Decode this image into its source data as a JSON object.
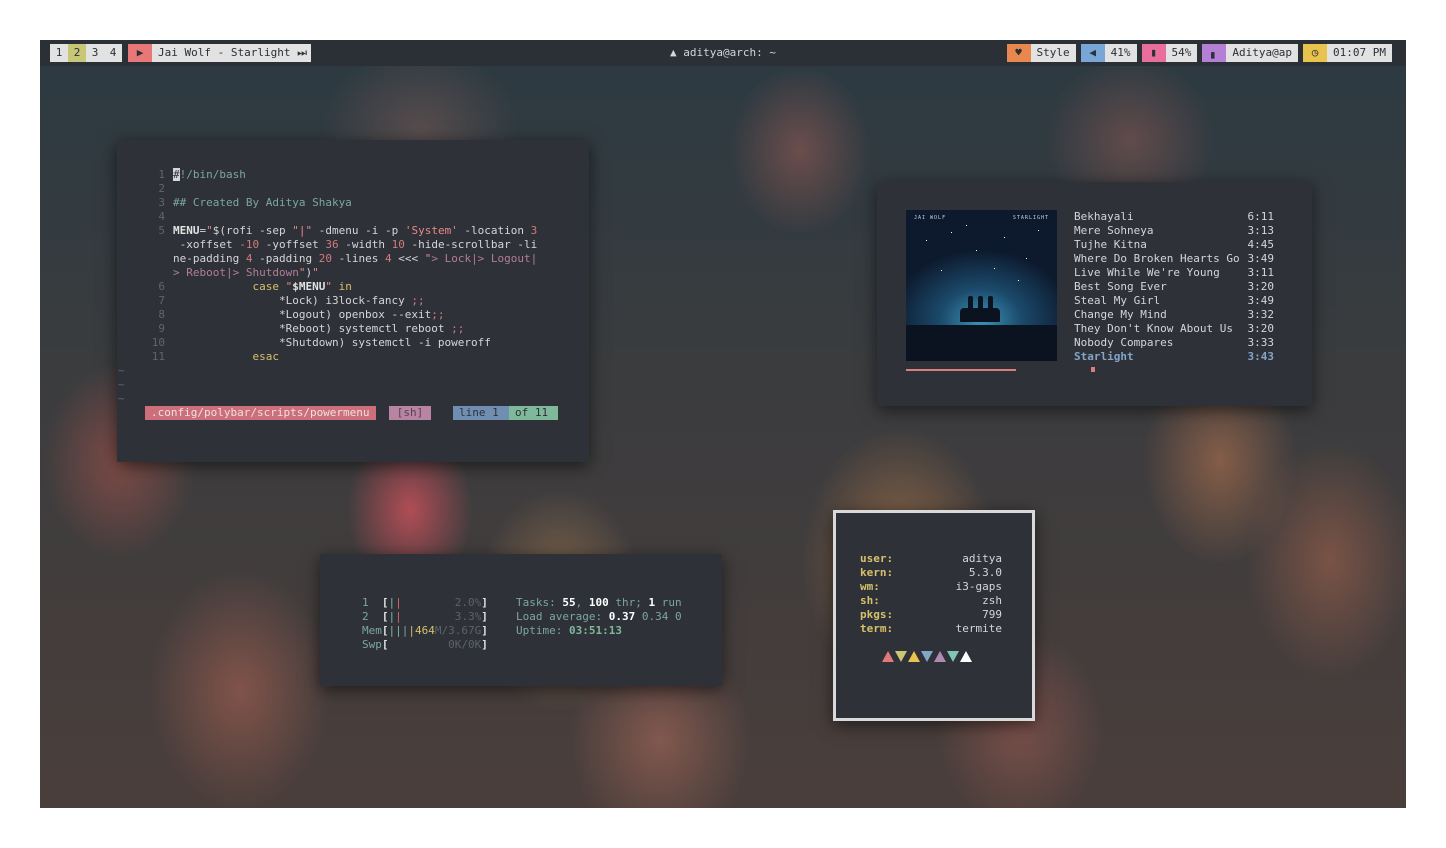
{
  "bar": {
    "workspaces": [
      "1",
      "2",
      "3",
      "4"
    ],
    "active_workspace_index": 1,
    "music": {
      "icon": "play-icon",
      "text": "Jai Wolf - Starlight",
      "next_icon": "skip-next-icon"
    },
    "window_title": "aditya@arch: ~",
    "modules": [
      {
        "icon": "heart-icon",
        "icon_glyph": "♥",
        "color": "#e8884f",
        "text": "Style"
      },
      {
        "icon": "volume-icon",
        "icon_glyph": "🔈",
        "color": "#78a6d6",
        "text": "41%"
      },
      {
        "icon": "battery-icon",
        "icon_glyph": "▮",
        "color": "#e86f9b",
        "text": "54%"
      },
      {
        "icon": "network-icon",
        "icon_glyph": "▖",
        "color": "#b57fd6",
        "text": "Aditya@ap"
      },
      {
        "icon": "clock-icon",
        "icon_glyph": "◷",
        "color": "#e8c44f",
        "text": "01:07 PM"
      }
    ]
  },
  "editor": {
    "file": ".config/polybar/scripts/powermenu",
    "filetype": "[sh]",
    "line": "line 1",
    "of": "of 11",
    "tilde": "~"
  },
  "music": {
    "cover_artist": "JAI WOLF",
    "cover_album": "STARLIGHT",
    "tracks": [
      {
        "title": "Bekhayali",
        "duration": "6:11"
      },
      {
        "title": "Mere Sohneya",
        "duration": "3:13"
      },
      {
        "title": "Tujhe Kitna",
        "duration": "4:45"
      },
      {
        "title": "Where Do Broken Hearts Go",
        "duration": "3:49"
      },
      {
        "title": "Live While We're Young",
        "duration": "3:11"
      },
      {
        "title": "Best Song Ever",
        "duration": "3:20"
      },
      {
        "title": "Steal My Girl",
        "duration": "3:49"
      },
      {
        "title": "Change My Mind",
        "duration": "3:32"
      },
      {
        "title": "They Don't Know About Us",
        "duration": "3:20"
      },
      {
        "title": "Nobody Compares",
        "duration": "3:33"
      },
      {
        "title": "Starlight",
        "duration": "3:43"
      }
    ],
    "current_index": 10,
    "progress": 0.58
  },
  "htop": {
    "cpu1": {
      "label": "1",
      "bar": "||",
      "pct": "2.0%"
    },
    "cpu2": {
      "label": "2",
      "bar": "||",
      "pct": "3.3%"
    },
    "mem": {
      "label": "Mem",
      "bar": "||||",
      "used": "464",
      "rest": "M/3.67G"
    },
    "swp": {
      "label": "Swp",
      "value": "0K/0K"
    },
    "tasks_label": "Tasks:",
    "tasks": "55",
    "thr": "100",
    "thr_label": "thr;",
    "run": "1",
    "run_label": "run",
    "load_label": "Load average:",
    "load1": "0.37",
    "load5": "0.34",
    "load15": "0",
    "uptime_label": "Uptime:",
    "uptime": "03:51:13"
  },
  "fetch": {
    "rows": [
      {
        "key": "user:",
        "value": "aditya"
      },
      {
        "key": "kern:",
        "value": "5.3.0"
      },
      {
        "key": "wm:",
        "value": "i3-gaps"
      },
      {
        "key": "sh:",
        "value": "zsh"
      },
      {
        "key": "pkgs:",
        "value": "799"
      },
      {
        "key": "term:",
        "value": "termite"
      }
    ],
    "palette": [
      "#e07a7a",
      "#c8c774",
      "#e8c44f",
      "#83a6c6",
      "#b28ab0",
      "#7fc4b4",
      "#ffffff"
    ]
  }
}
